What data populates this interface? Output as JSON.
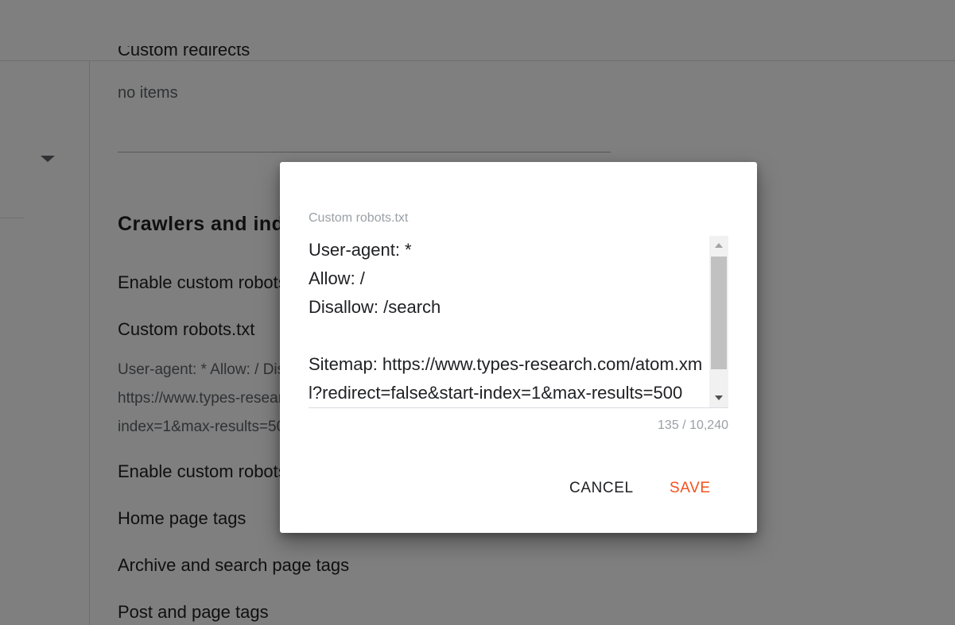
{
  "background": {
    "redirects_title": "Custom redirects",
    "redirects_value": "no items",
    "section_title": "Crawlers and indexing",
    "settings": [
      {
        "label": "Enable custom robots.txt"
      },
      {
        "label": "Custom robots.txt"
      },
      {
        "label": "Enable custom robots header tags"
      },
      {
        "label": "Home page tags"
      },
      {
        "label": "Archive and search page tags"
      },
      {
        "label": "Post and page tags"
      }
    ],
    "robots_preview": [
      "User-agent: * Allow: / Disallow: /search Sitemap:",
      "https://www.types-research.com/atom.xml?redirect=false&start-",
      "index=1&max-results=500"
    ]
  },
  "dialog": {
    "field_label": "Custom robots.txt",
    "textarea_value": "User-agent: *\nAllow: /\nDisallow: /search\n\nSitemap: https://www.types-research.com/atom.xml?redirect=false&start-index=1&max-results=500",
    "char_count": "135 / 10,240",
    "cancel_label": "CANCEL",
    "save_label": "SAVE"
  },
  "colors": {
    "accent": "#f4511e",
    "scrim": "rgba(0,0,0,0.5)"
  }
}
